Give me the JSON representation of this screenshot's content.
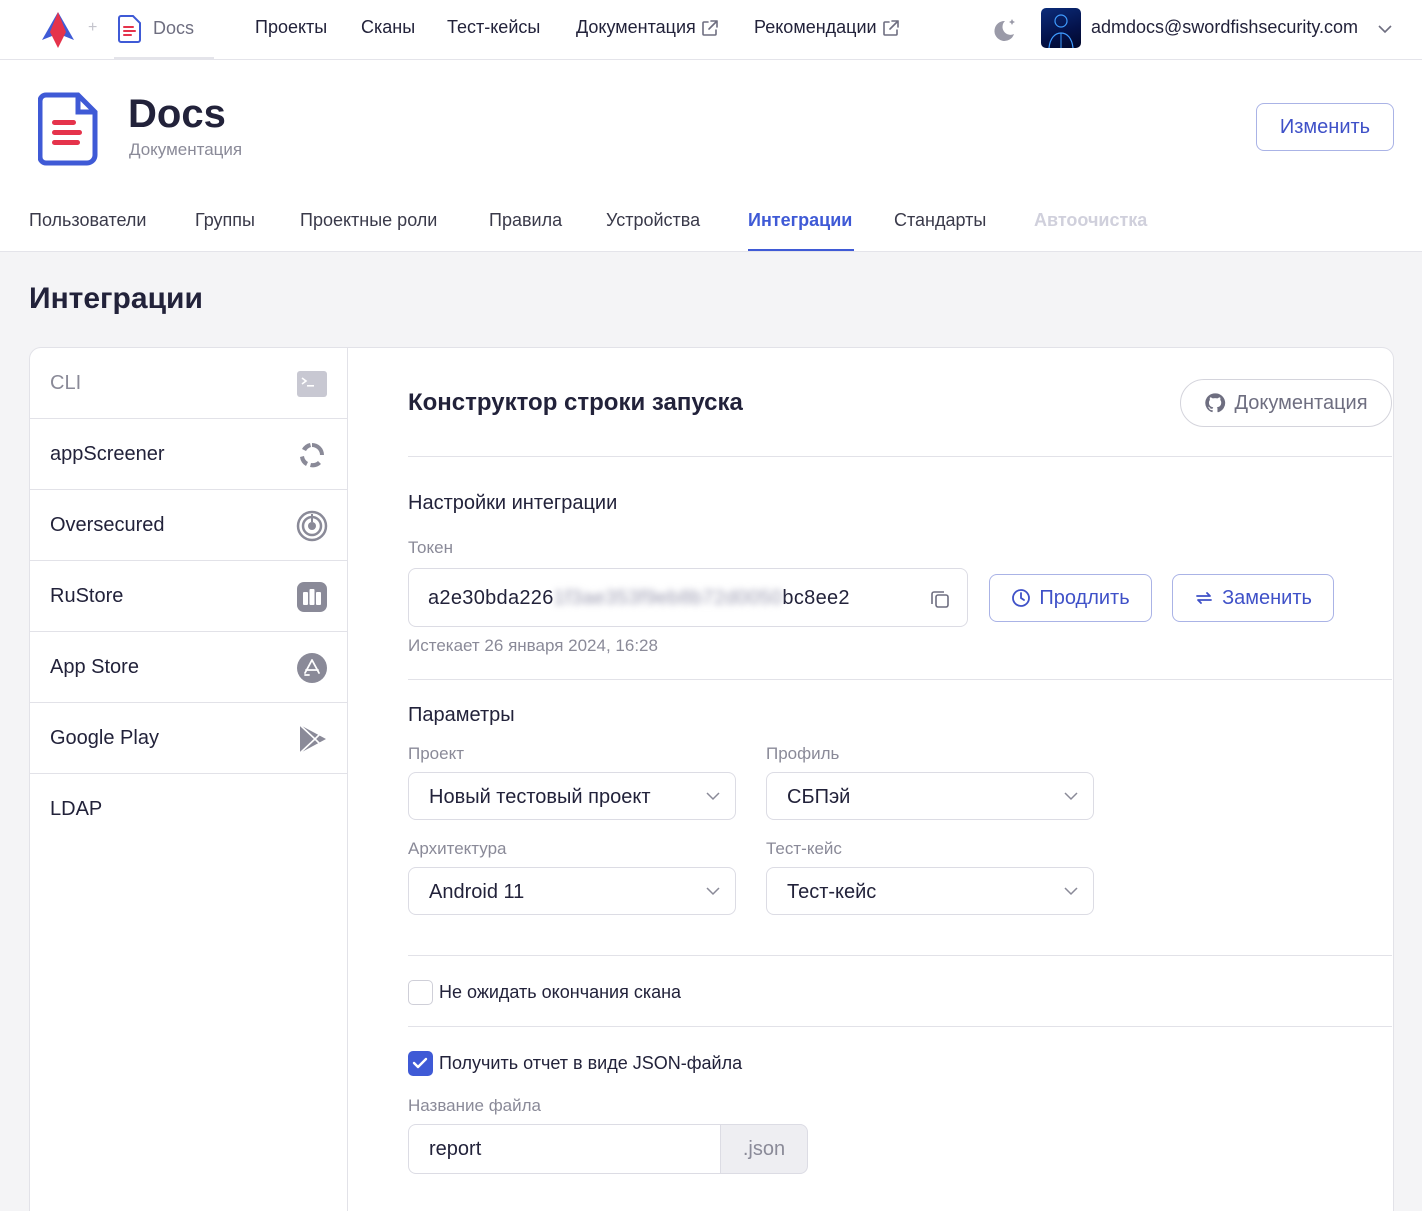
{
  "topbar": {
    "crumb_label": "Docs",
    "nav": [
      {
        "label": "Проекты",
        "external": false
      },
      {
        "label": "Сканы",
        "external": false
      },
      {
        "label": "Тест-кейсы",
        "external": false
      },
      {
        "label": "Документация",
        "external": true
      },
      {
        "label": "Рекомендации",
        "external": true
      }
    ],
    "user_email": "admdocs@swordfishsecurity.com"
  },
  "header": {
    "title": "Docs",
    "subtitle": "Документация",
    "edit_label": "Изменить",
    "tabs": [
      {
        "label": "Пользователи",
        "state": "normal"
      },
      {
        "label": "Группы",
        "state": "normal"
      },
      {
        "label": "Проектные роли",
        "state": "normal"
      },
      {
        "label": "Правила",
        "state": "normal"
      },
      {
        "label": "Устройства",
        "state": "normal"
      },
      {
        "label": "Интеграции",
        "state": "active"
      },
      {
        "label": "Стандарты",
        "state": "normal"
      },
      {
        "label": "Автоочистка",
        "state": "disabled"
      }
    ]
  },
  "page": {
    "title": "Интеграции"
  },
  "sidebar": {
    "items": [
      {
        "label": "CLI",
        "icon": "terminal-icon",
        "active": true
      },
      {
        "label": "appScreener",
        "icon": "appscreener-icon",
        "active": false
      },
      {
        "label": "Oversecured",
        "icon": "oversecured-icon",
        "active": false
      },
      {
        "label": "RuStore",
        "icon": "rustore-icon",
        "active": false
      },
      {
        "label": "App Store",
        "icon": "app-store-icon",
        "active": false
      },
      {
        "label": "Google Play",
        "icon": "google-play-icon",
        "active": false
      },
      {
        "label": "LDAP",
        "icon": "",
        "active": false
      }
    ]
  },
  "main": {
    "title": "Конструктор строки запуска",
    "doc_button": "Документация",
    "integration_settings_title": "Настройки интеграции",
    "token": {
      "label": "Токен",
      "prefix": "a2e30bda226",
      "masked": "1f3ae353f9eb8b72d0050",
      "suffix": "bc8ee2",
      "expires": "Истекает 26 января 2024, 16:28"
    },
    "extend_button": "Продлить",
    "replace_button": "Заменить",
    "params_title": "Параметры",
    "fields": {
      "project": {
        "label": "Проект",
        "value": "Новый тестовый проект"
      },
      "profile": {
        "label": "Профиль",
        "value": "СБПэй"
      },
      "architecture": {
        "label": "Архитектура",
        "value": "Android 11"
      },
      "testcase": {
        "label": "Тест-кейс",
        "value": "Тест-кейс"
      }
    },
    "no_wait": {
      "label": "Не ожидать окончания скана",
      "checked": false
    },
    "json_report": {
      "label": "Получить отчет в виде JSON-файла",
      "checked": true
    },
    "filename": {
      "label": "Название файла",
      "value": "report",
      "suffix": ".json"
    }
  },
  "colors": {
    "accent": "#3f5ad6",
    "logo_red": "#e5334b",
    "logo_blue": "#3f5ad6"
  }
}
